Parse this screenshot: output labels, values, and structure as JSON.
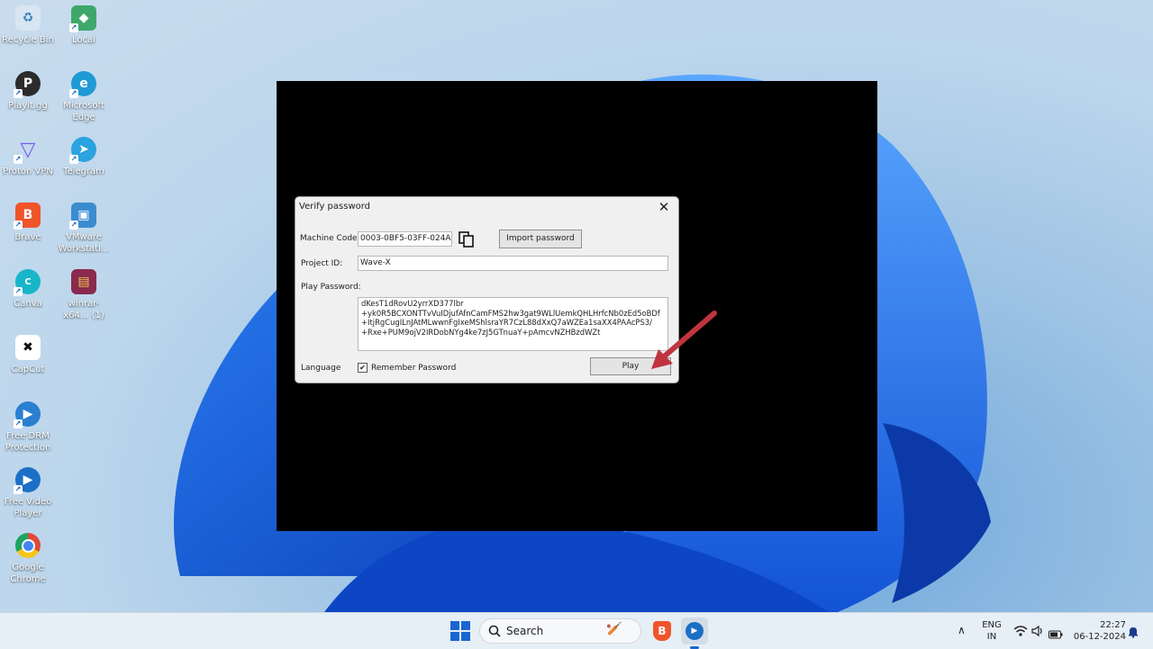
{
  "desktop": {
    "icons": [
      {
        "label": "Recycle Bin",
        "glyph": "♻",
        "color": "#d8e6f3"
      },
      {
        "label": "Local",
        "glyph": "◆",
        "color": "#3ea86a"
      },
      {
        "label": "Playit.gg",
        "glyph": "P",
        "color": "#2b2b2b"
      },
      {
        "label": "Microsoft Edge",
        "glyph": "e",
        "color": "#1f9ad6"
      },
      {
        "label": "Proton VPN",
        "glyph": "▽",
        "color": "#7a5af0"
      },
      {
        "label": "Telegram",
        "glyph": "➤",
        "color": "#2aa3df"
      },
      {
        "label": "Brave",
        "glyph": "B",
        "color": "#f0542b"
      },
      {
        "label": "VMware Workstati...",
        "glyph": "▣",
        "color": "#3a8ccf"
      },
      {
        "label": "Canva",
        "glyph": "C",
        "color": "#19b5c9"
      },
      {
        "label": "winrar-x64... (1)",
        "glyph": "▤",
        "color": "#8a2a4e"
      },
      {
        "label": "CapCut",
        "glyph": "✖",
        "color": "#111111"
      },
      {
        "label": "Free DRM Protection",
        "glyph": "▶",
        "color": "#2a7fd1"
      },
      {
        "label": "Free Video Player",
        "glyph": "▶",
        "color": "#1c6fc6"
      },
      {
        "label": "Google Chrome",
        "glyph": "●",
        "color": "#dd4b39"
      }
    ]
  },
  "dialog": {
    "title": "Verify password",
    "close": "✕",
    "machine_code_label": "Machine Code:",
    "machine_code_value": "0003-0BF5-03FF-024A",
    "import_button": "Import password",
    "project_id_label": "Project ID:",
    "project_id_value": "Wave-X",
    "play_password_label": "Play Password:",
    "play_password_value": "dKesT1dRovU2yrrXD377lbr\n+yk0R5BCXONTTvVuIDjufAfnCamFMS2hw3gat9WLlUemkQHLHrfcNb0zEd5oBDf\n+ItjRgCugILnJAtMLwwnFgIxeMShlsraYR7CzL88dXxQ7aWZEa1saXX4PAAcPS3/\n+Rxe+PUM9ojV2IRDobNYg4ke7zJ5GTnuaY+pAmcvNZHBzdWZt",
    "language_label": "Language",
    "remember_label": "Remember Password",
    "remember_checked": "✔",
    "play_button": "Play",
    "copy_icon": "copy-icon"
  },
  "taskbar": {
    "search_placeholder": "Search",
    "lang_line1": "ENG",
    "lang_line2": "IN",
    "time": "22:27",
    "date": "06-12-2024",
    "tray_chevron": "∧"
  },
  "colors": {
    "arrow": "#c0343f",
    "windows_blue": "#1a66d0"
  }
}
